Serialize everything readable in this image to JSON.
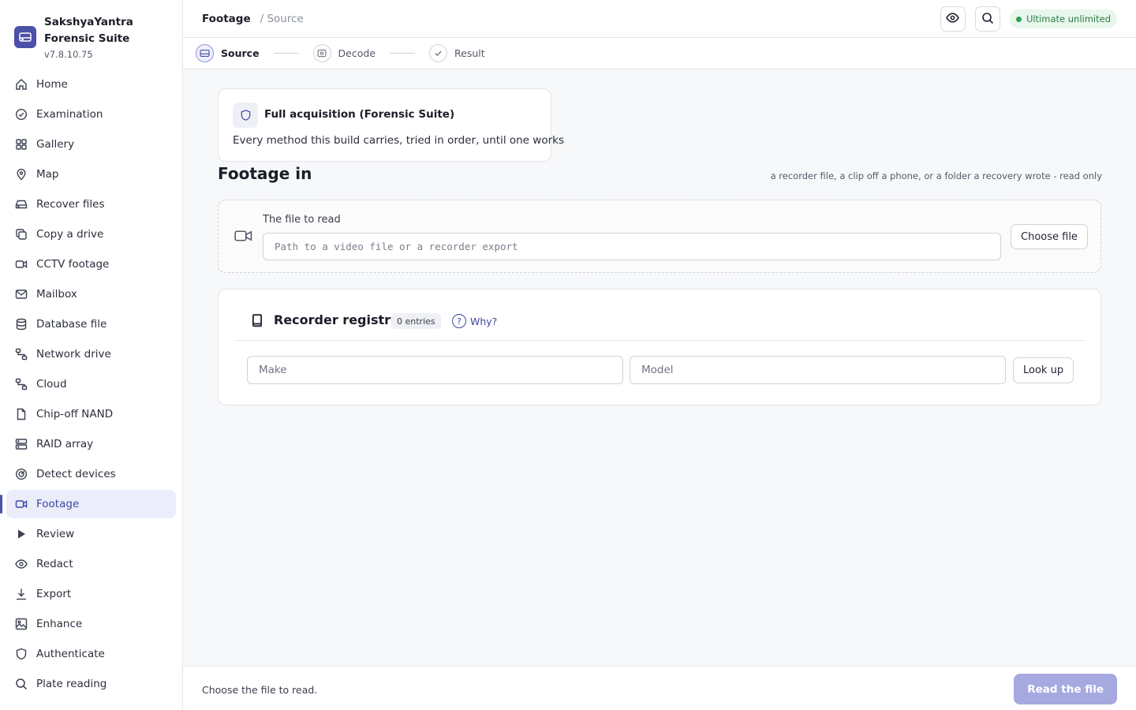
{
  "app": {
    "name": "SakshyaYantra Forensic Suite",
    "version": "v7.8.10.75"
  },
  "sidebar": {
    "items": [
      {
        "label": "Home",
        "icon": "home-icon"
      },
      {
        "label": "Examination",
        "icon": "check-circle-icon"
      },
      {
        "label": "Gallery",
        "icon": "grid-icon"
      },
      {
        "label": "Map",
        "icon": "map-pin-icon"
      },
      {
        "label": "Recover files",
        "icon": "hard-drive-icon"
      },
      {
        "label": "Copy a drive",
        "icon": "copy-icon"
      },
      {
        "label": "CCTV footage",
        "icon": "video-icon"
      },
      {
        "label": "Mailbox",
        "icon": "mail-icon"
      },
      {
        "label": "Database file",
        "icon": "database-icon"
      },
      {
        "label": "Network drive",
        "icon": "network-icon"
      },
      {
        "label": "Cloud",
        "icon": "network-icon"
      },
      {
        "label": "Chip-off NAND",
        "icon": "file-icon"
      },
      {
        "label": "RAID array",
        "icon": "server-icon"
      },
      {
        "label": "Detect devices",
        "icon": "radar-icon"
      },
      {
        "label": "Footage",
        "icon": "video-icon",
        "active": true
      },
      {
        "label": "Review",
        "icon": "play-icon"
      },
      {
        "label": "Redact",
        "icon": "eye-icon"
      },
      {
        "label": "Export",
        "icon": "download-icon"
      },
      {
        "label": "Enhance",
        "icon": "image-icon"
      },
      {
        "label": "Authenticate",
        "icon": "shield-icon"
      },
      {
        "label": "Plate reading",
        "icon": "search-icon"
      }
    ]
  },
  "header": {
    "breadcrumb_current": "Footage",
    "breadcrumb_rest": "/ Source",
    "plan_badge": "Ultimate unlimited",
    "plan_color": "#27a552"
  },
  "stepper": {
    "steps": [
      {
        "label": "Source",
        "active": true
      },
      {
        "label": "Decode",
        "active": false
      },
      {
        "label": "Result",
        "active": false
      }
    ]
  },
  "mode": {
    "title": "Full acquisition (Forensic Suite)",
    "description": "Every method this build carries, tried in order, until one works"
  },
  "section": {
    "title": "Footage in",
    "note": "a recorder file, a clip off a phone, or a folder a recovery wrote - read only"
  },
  "file": {
    "label": "The file to read",
    "placeholder": "Path to a video file or a recorder export",
    "value": "",
    "choose_label": "Choose file"
  },
  "registry": {
    "title": "Recorder registry",
    "count": "0 entries",
    "why_label": "Why?",
    "make_placeholder": "Make",
    "model_placeholder": "Model",
    "lookup_label": "Look up"
  },
  "footer": {
    "message": "Choose the file to read.",
    "primary_label": "Read the file"
  },
  "colors": {
    "accent": "#4b50a8",
    "accent_disabled": "#a5a9e0"
  }
}
